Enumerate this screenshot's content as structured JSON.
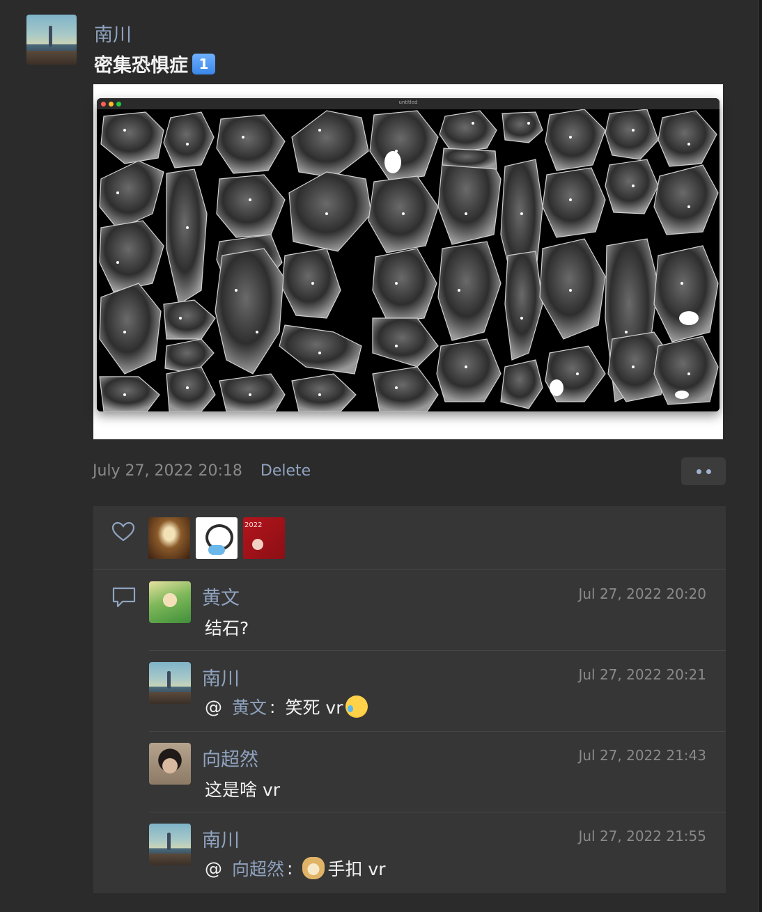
{
  "post": {
    "author": "南川",
    "text": "密集恐惧症",
    "keycap_emoji": "1",
    "screenshot_window_title": "untitled",
    "timestamp": "July 27, 2022 20:18",
    "delete_label": "Delete"
  },
  "icons": {
    "more": "more-dots-icon",
    "like": "heart-icon",
    "comment": "comment-icon"
  },
  "likes": {
    "count_shown": 3,
    "card_text": "2022"
  },
  "comments": [
    {
      "author": "黄文",
      "time": "Jul 27, 2022 20:20",
      "text": "结石?"
    },
    {
      "author": "南川",
      "time": "Jul 27, 2022 20:21",
      "prefix": "@",
      "mention": "黄文",
      "sep": ":",
      "text": "笑死 vr",
      "emoji": "laughing-tears-emoji"
    },
    {
      "author": "向超然",
      "time": "Jul 27, 2022 21:43",
      "text": "这是啥 vr"
    },
    {
      "author": "南川",
      "time": "Jul 27, 2022 21:55",
      "prefix": "@",
      "mention": "向超然",
      "sep": ":",
      "emoji": "doge-emoji",
      "text": "手扣 vr"
    }
  ],
  "colors": {
    "background": "#2b2b2b",
    "panel": "#363636",
    "link": "#8fa3bf",
    "muted": "#8a8a8a"
  }
}
